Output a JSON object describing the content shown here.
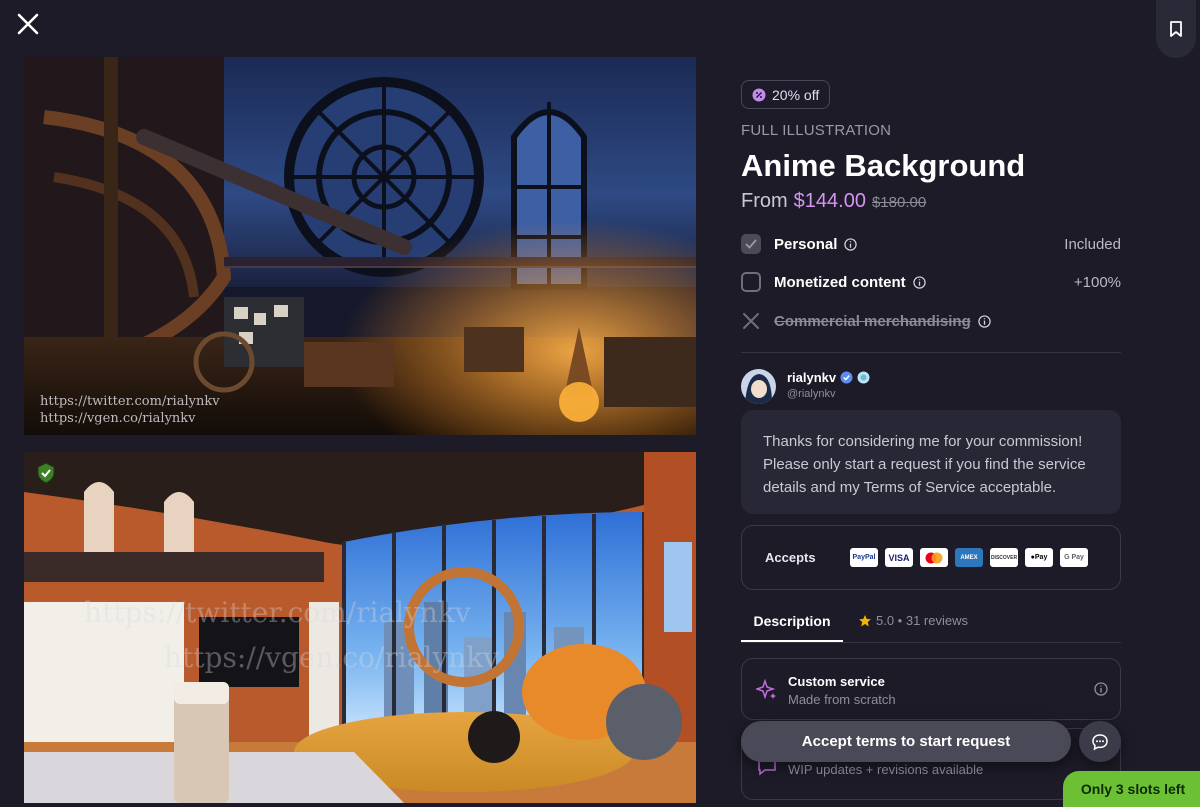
{
  "offer": {
    "discount_label": "20% off",
    "category": "FULL ILLUSTRATION",
    "title": "Anime Background",
    "price_prefix": "From",
    "price_current": "$144.00",
    "price_original": "$180.00"
  },
  "options": [
    {
      "label": "Personal",
      "right": "Included",
      "checked": true,
      "disabled": false
    },
    {
      "label": "Monetized content",
      "right": "+100%",
      "checked": false,
      "disabled": false
    },
    {
      "label": "Commercial merchandising",
      "right": "",
      "checked": false,
      "disabled": true
    }
  ],
  "artist": {
    "name": "rialynkv",
    "handle": "@rialynkv",
    "message": "Thanks for considering me for your commission! Please only start a request if you find the service details and my Terms of Service acceptable."
  },
  "payments": {
    "label": "Accepts",
    "methods": [
      "PayPal",
      "VISA",
      "Mastercard",
      "AMEX",
      "DISCOVER",
      "Apple Pay",
      "G Pay"
    ]
  },
  "tabs": {
    "description": "Description",
    "reviews": "5.0 • 31 reviews"
  },
  "services": [
    {
      "title": "Custom service",
      "subtitle": "Made from scratch"
    },
    {
      "title": "",
      "subtitle": "WIP updates + revisions available"
    }
  ],
  "actions": {
    "accept": "Accept terms to start request",
    "slots": "Only 3 slots left"
  },
  "gallery": {
    "watermark_lines": [
      "https://twitter.com/rialynkv",
      "https://vgen.co/rialynkv"
    ],
    "watermark_big": [
      "https://twitter.com/rialynkv",
      "https://vgen.co/rialynkv"
    ]
  },
  "colors": {
    "background": "#1c1b27",
    "accent_price": "#d596f2",
    "slots_badge": "#6cc034"
  }
}
